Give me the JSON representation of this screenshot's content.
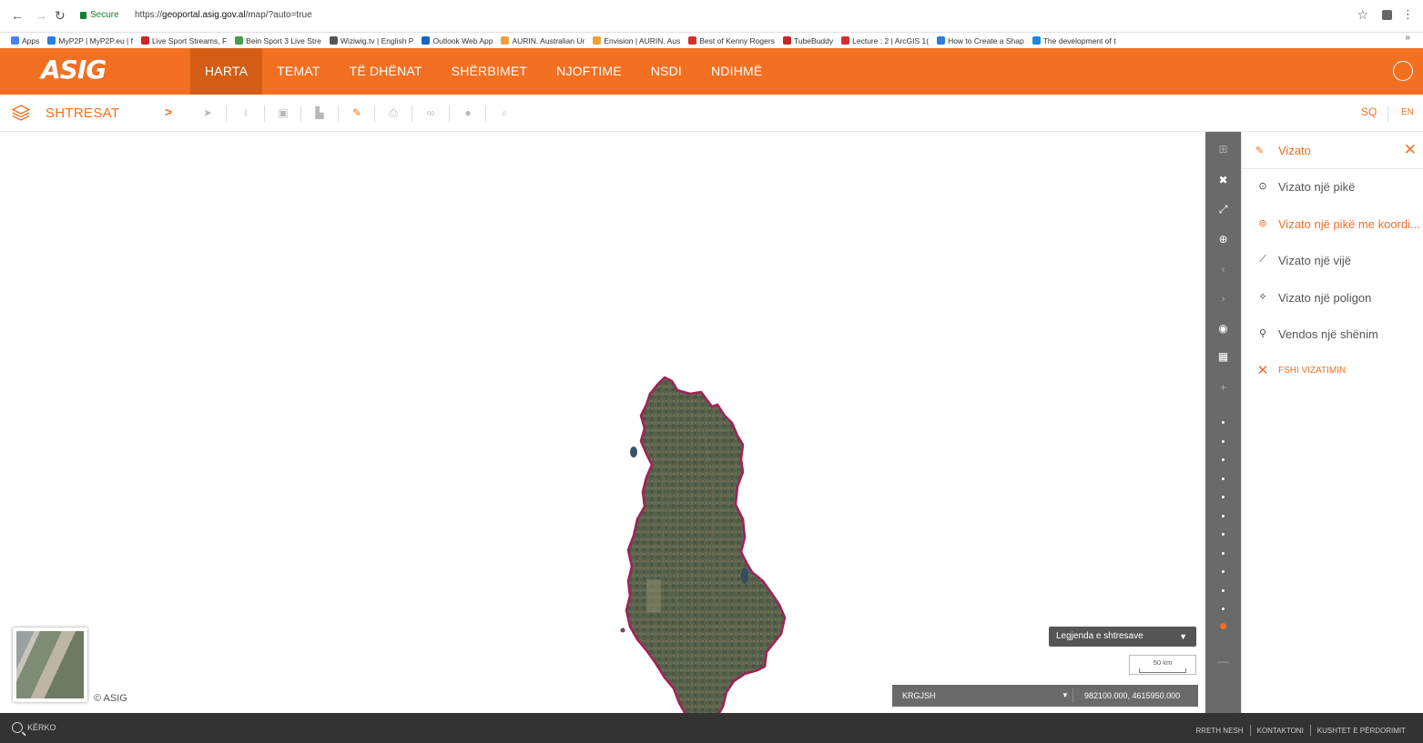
{
  "browser": {
    "secure_label": "Secure",
    "url_scheme": "https://",
    "url_host": "geoportal.asig.gov.al",
    "url_path": "/map/?auto=true",
    "bookmarks": [
      {
        "label": "Apps",
        "color": "#4285f4"
      },
      {
        "label": "MyP2P | MyP2P.eu | f",
        "color": "#2a7de1"
      },
      {
        "label": "Live Sport Streams, F",
        "color": "#c62828"
      },
      {
        "label": "Bein Sport 3 Live Stre",
        "color": "#43a047"
      },
      {
        "label": "Wiziwig.tv | English P",
        "color": "#555555"
      },
      {
        "label": "Outlook Web App",
        "color": "#1565c0"
      },
      {
        "label": "AURIN. Australian Ur",
        "color": "#e8a33d"
      },
      {
        "label": "Envision | AURIN. Aus",
        "color": "#e8a33d"
      },
      {
        "label": "Best of Kenny Rogers",
        "color": "#d32f2f"
      },
      {
        "label": "TubeBuddy",
        "color": "#c62828"
      },
      {
        "label": "Lecture : 2 | ArcGIS 1(",
        "color": "#d32f2f"
      },
      {
        "label": "How to Create a Shap",
        "color": "#2a7de1"
      },
      {
        "label": "The development of t",
        "color": "#1e88e5"
      }
    ],
    "more_bookmarks": "»"
  },
  "header": {
    "logo": "ASIG",
    "nav": [
      {
        "label": "HARTA",
        "active": true
      },
      {
        "label": "TEMAT",
        "active": false
      },
      {
        "label": "TË DHËNAT",
        "active": false
      },
      {
        "label": "SHËRBIMET",
        "active": false
      },
      {
        "label": "NJOFTIME",
        "active": false
      },
      {
        "label": "NSDI",
        "active": false
      },
      {
        "label": "NDIHMË",
        "active": false
      }
    ]
  },
  "toolbar": {
    "layers_label": "SHTRESAT",
    "expand_icon": ">",
    "lang_sq": "SQ",
    "lang_en": "EN"
  },
  "map": {
    "copyright": "© ASIG",
    "legend_label": "Legjenda e shtresave",
    "scale_label": "50 km",
    "crs_name": "KRGJSH",
    "coordinates": "982100.000, 4615950.000"
  },
  "draw_panel": {
    "title": "Vizato",
    "items": [
      {
        "label": "Vizato një pikë",
        "icon": "point-icon"
      },
      {
        "label": "Vizato një pikë me koordi...",
        "icon": "point-coords-icon"
      },
      {
        "label": "Vizato një vijë",
        "icon": "line-icon"
      },
      {
        "label": "Vizato një poligon",
        "icon": "polygon-icon"
      },
      {
        "label": "Vendos një shënim",
        "icon": "annotation-icon"
      },
      {
        "label": "FSHI VIZATIMIN",
        "icon": "close-icon"
      }
    ]
  },
  "footer": {
    "search_label": "KËRKO",
    "links": [
      "RRETH NESH",
      "KONTAKTONI",
      "KUSHTET E PËRDORIMIT"
    ]
  },
  "colors": {
    "brand_orange": "#f36f21",
    "nav_active": "#d45d16",
    "strip_gray": "#6a6a6a",
    "footer_dark": "#333333",
    "border_magenta": "#a0225a"
  }
}
